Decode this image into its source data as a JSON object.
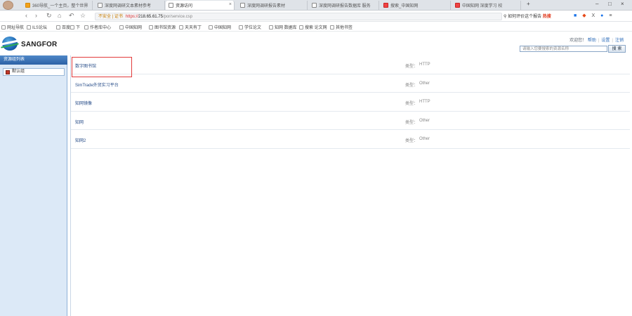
{
  "browser": {
    "tabs": [
      {
        "label": "360导航_一个主页，整个世界",
        "icon": "orange",
        "active": false
      },
      {
        "label": "深度网调研文本素材参考",
        "icon": "plain",
        "active": false
      },
      {
        "label": "资源访问",
        "icon": "plain",
        "active": true
      },
      {
        "label": "深度网调研报告素材",
        "icon": "plain",
        "active": false
      },
      {
        "label": "深度网调研报告数据库 服务",
        "icon": "plain",
        "active": false
      },
      {
        "label": "搜索_中国知网",
        "icon": "red",
        "active": false
      },
      {
        "label": "中国知网 深度学习 校",
        "icon": "red",
        "active": false
      }
    ],
    "address": {
      "warning": "不安全 | 证书",
      "protocol": "https://",
      "host": "218.65.61.75",
      "path": "/por/service.csp"
    },
    "search_hint": "如何评价这个报告",
    "search_hot": "热搜",
    "bookmarks": [
      "网址导航",
      "ILS论坛",
      "百度",
      "下",
      "作者库中心",
      "中国知网",
      "图书馆资源",
      "天天有丁",
      "中国知网",
      "学位论文",
      "知网 数据库",
      "搜索 论文网",
      "其他书签"
    ]
  },
  "header": {
    "logo_text": "SANGFOR",
    "links": {
      "hello": "欢迎您！",
      "help": "帮助",
      "settings": "设置",
      "logout": "注销"
    },
    "search_placeholder": "请输入您要搜索的资源名称",
    "search_button": "搜 索"
  },
  "sidebar": {
    "title": "资源组列表",
    "items": [
      {
        "label": "默认组"
      }
    ]
  },
  "resources": [
    {
      "name": "数字图书馆",
      "type_label": "类型：",
      "type_value": "HTTP"
    },
    {
      "name": "SimTrade外贸实习平台",
      "type_label": "类型：",
      "type_value": "Other"
    },
    {
      "name": "知网镜像",
      "type_label": "类型：",
      "type_value": "HTTP"
    },
    {
      "name": "知网",
      "type_label": "类型：",
      "type_value": "Other"
    },
    {
      "name": "知网2",
      "type_label": "类型：",
      "type_value": "Other"
    }
  ]
}
